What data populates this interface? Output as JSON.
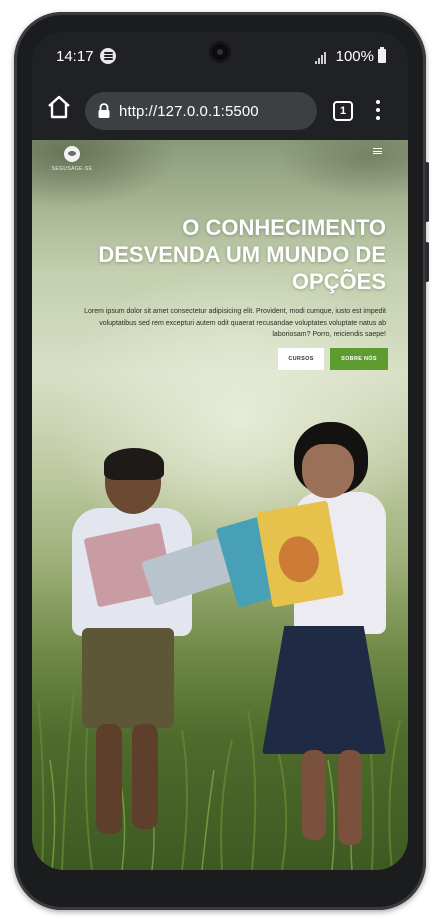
{
  "status_bar": {
    "time": "14:17",
    "battery": "100%",
    "icons": [
      "spotify-icon",
      "signal-icon",
      "battery-icon"
    ]
  },
  "browser": {
    "url": "http://127.0.0.1:5500",
    "tab_count": "1",
    "icons": [
      "home-icon",
      "lock-icon",
      "more-vert-icon"
    ]
  },
  "page": {
    "brand_text": "SEGUSAGE-SE",
    "hero_title_lines": [
      "O CONHECIMENTO",
      "DESVENDA UM MUNDO DE",
      "OPÇÕES"
    ],
    "hero_text_lines": [
      "Lorem ipsum dolor sit amet consectetur adipisicing elit. Provident, modi cumque, iusto est impedit",
      "voluptatibus sed rem excepturi autem odit quaerat recusandae voluptates voluptate natus ab",
      "laboriosam? Porro, reiciendis saepe!"
    ],
    "buttons": {
      "courses": "CURSOS",
      "about": "SOBRE NÓS"
    },
    "colors": {
      "accent_green": "#5f9c2f",
      "dark_ui": "#202124",
      "url_bar": "#3c4043"
    }
  }
}
